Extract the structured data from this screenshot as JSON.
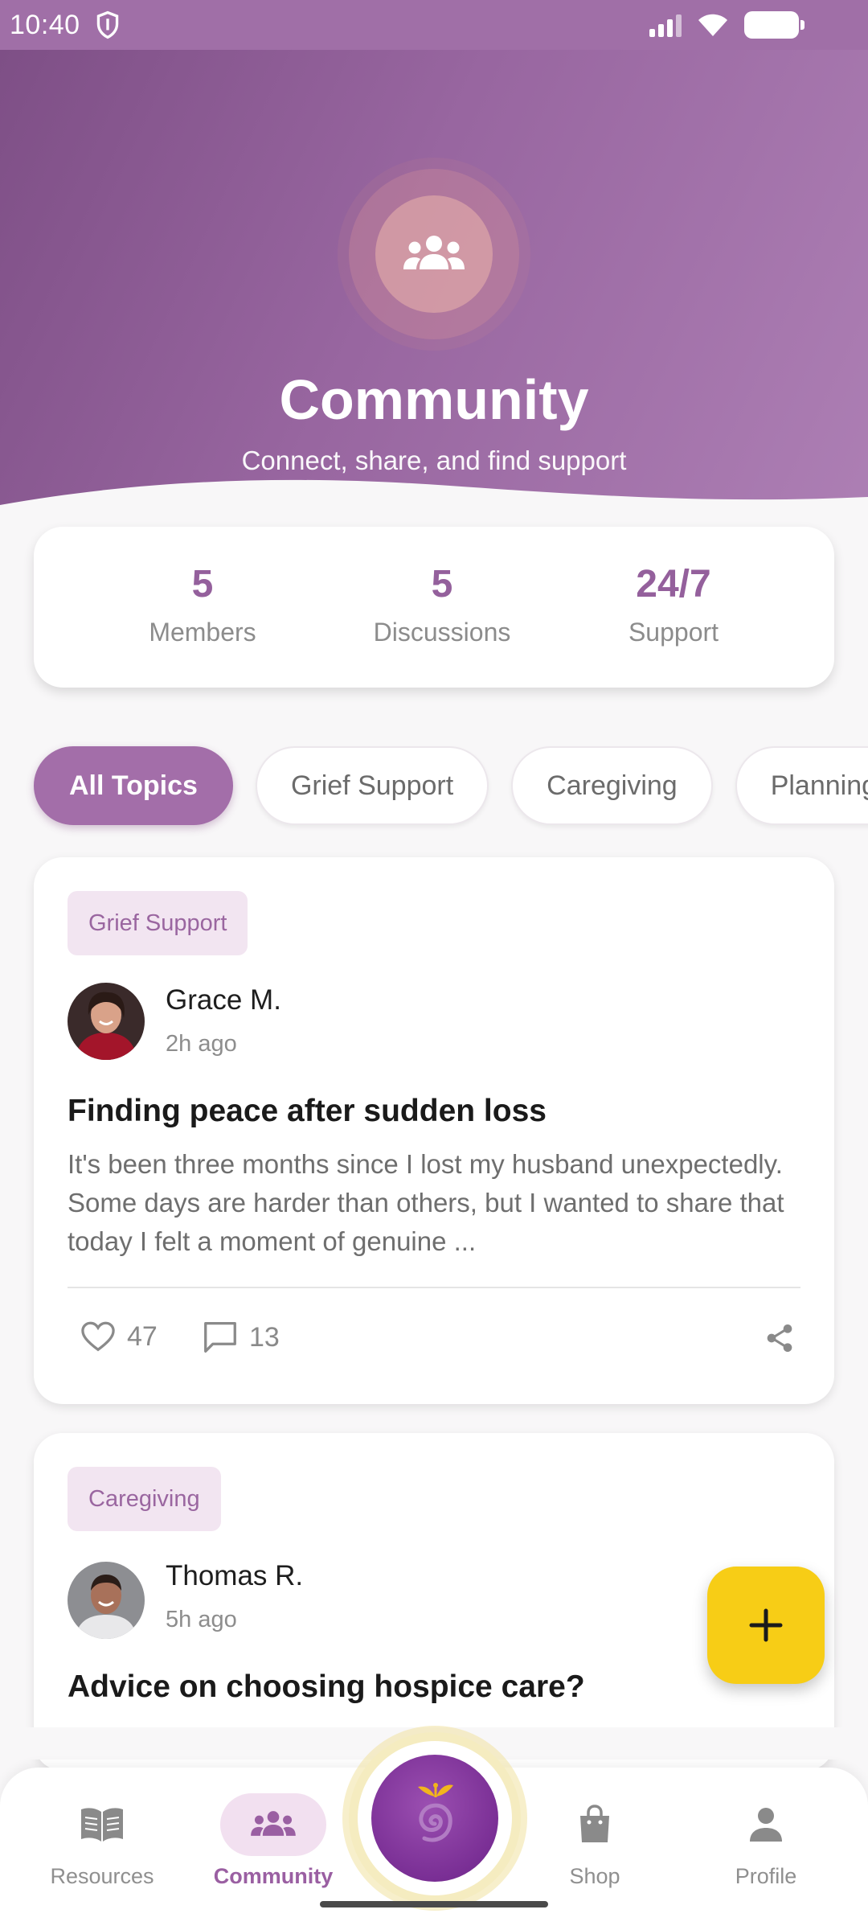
{
  "status_bar": {
    "time": "10:40"
  },
  "hero": {
    "title": "Community",
    "subtitle": "Connect, share, and find support"
  },
  "stats": [
    {
      "value": "5",
      "label": "Members"
    },
    {
      "value": "5",
      "label": "Discussions"
    },
    {
      "value": "24/7",
      "label": "Support"
    }
  ],
  "filters": [
    "All Topics",
    "Grief Support",
    "Caregiving",
    "Planning"
  ],
  "posts": [
    {
      "tag": "Grief Support",
      "author": "Grace M.",
      "time": "2h ago",
      "title": "Finding peace after sudden loss",
      "body": "It's been three months since I lost my husband unexpectedly. Some days are harder than others, but I wanted to share that today I felt a moment of genuine ...",
      "likes": "47",
      "comments": "13"
    },
    {
      "tag": "Caregiving",
      "author": "Thomas R.",
      "time": "5h ago",
      "title": "Advice on choosing hospice care?"
    }
  ],
  "nav": {
    "resources": "Resources",
    "community": "Community",
    "shop": "Shop",
    "profile": "Profile"
  },
  "colors": {
    "brand": "#a36ea9",
    "accent": "#f7cd16"
  }
}
